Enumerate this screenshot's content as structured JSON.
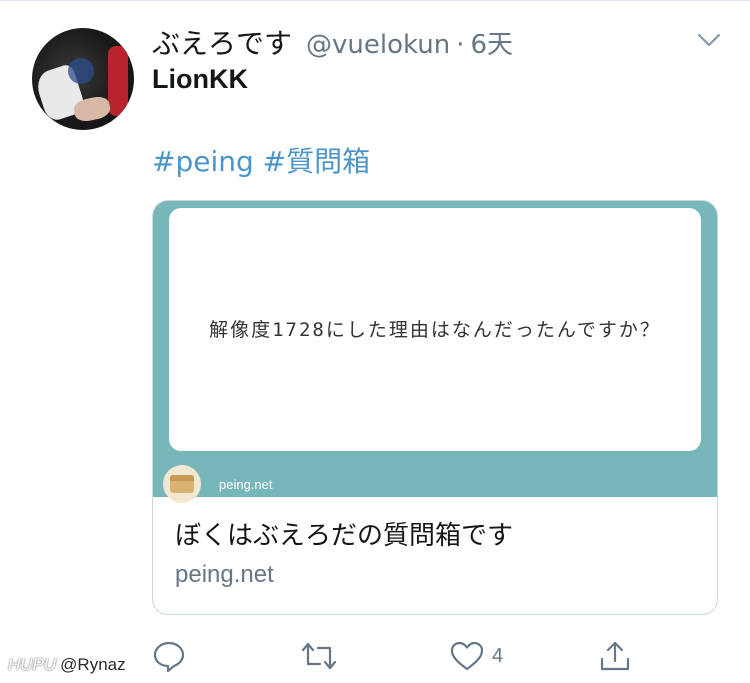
{
  "tweet": {
    "display_name": "ぶえろです",
    "handle": "@vuelokun",
    "separator": "·",
    "time": "6天",
    "text_line1": "LionKK",
    "hashtags": [
      "#peing",
      "#質問箱"
    ]
  },
  "card": {
    "question_text": "解像度1728にした理由はなんだったんですか？",
    "image_site": "peing.net",
    "title": "ぼくはぶえろだの質問箱です",
    "domain": "peing.net"
  },
  "actions": {
    "reply_icon": "reply-icon",
    "retweet_icon": "retweet-icon",
    "like_icon": "heart-icon",
    "like_count": "4",
    "share_icon": "share-icon"
  },
  "watermark": {
    "brand": "HUPU",
    "user": "@Rynaz"
  },
  "colors": {
    "link": "#4c95c9",
    "muted": "#657786",
    "card_bg": "#77b6b9"
  }
}
